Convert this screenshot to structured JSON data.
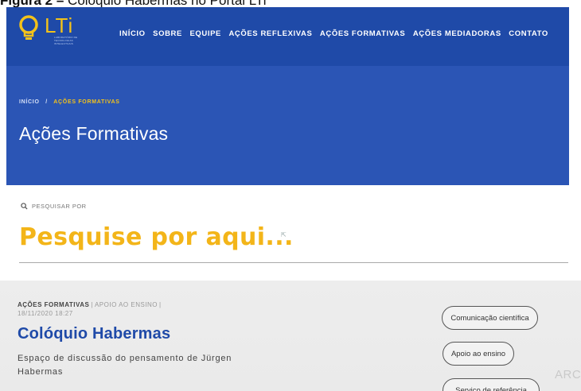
{
  "caption": {
    "prefix": "Figura 2 –",
    "text": "Colóquio Habermas no Portal LTi"
  },
  "header": {
    "logo_text": "LTi",
    "logo_tagline": "LABORATÓRIO DE TECNOLOGIAS INTELECTUAIS",
    "nav": [
      {
        "label": "INÍCIO"
      },
      {
        "label": "SOBRE"
      },
      {
        "label": "EQUIPE"
      },
      {
        "label": "AÇÕES REFLEXIVAS"
      },
      {
        "label": "AÇÕES FORMATIVAS"
      },
      {
        "label": "AÇÕES MEDIADORAS"
      },
      {
        "label": "CONTATO"
      }
    ]
  },
  "hero": {
    "breadcrumb_home": "INÍCIO",
    "breadcrumb_sep": "/",
    "breadcrumb_current": "AÇÕES FORMATIVAS",
    "title": "Ações Formativas"
  },
  "search": {
    "label": "PESQUISAR POR",
    "placeholder": "Pesquise por aqui...",
    "icon": "search-icon"
  },
  "post": {
    "category": "AÇÕES FORMATIVAS",
    "subcategory": "APOIO AO ENSINO",
    "date": "18/11/2020 18:27",
    "title": "Colóquio Habermas",
    "excerpt": "Espaço de discussão do pensamento de Jürgen Habermas",
    "tags": [
      {
        "label": "Comunicação científica"
      },
      {
        "label": "Apoio ao ensino"
      },
      {
        "label": "Serviço de referência"
      }
    ]
  },
  "watermark": "ARC",
  "colors": {
    "header_bg": "#1f4aa8",
    "hero_bg": "#2b55b5",
    "accent_yellow": "#f3b519",
    "title_blue": "#1f4aa8"
  }
}
